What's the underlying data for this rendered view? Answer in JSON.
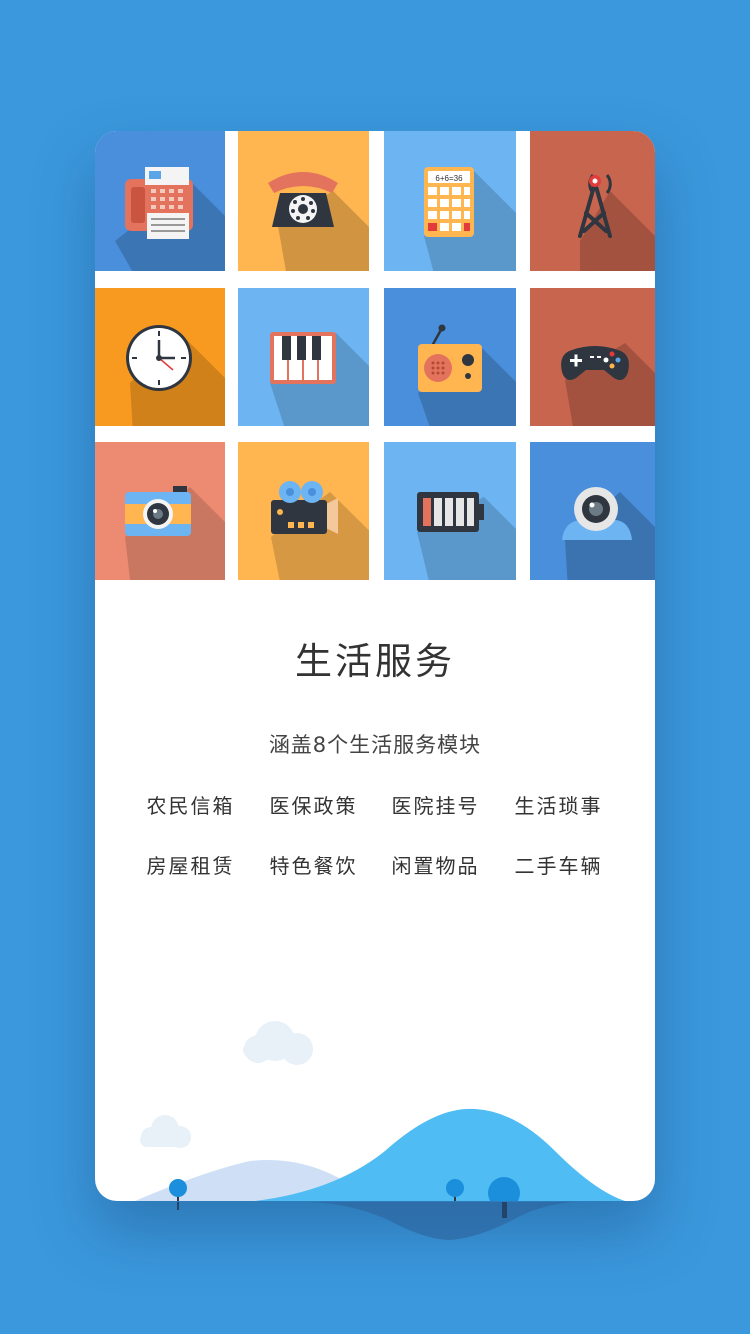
{
  "page": {
    "title": "生活服务",
    "subtitle": "涵盖8个生活服务模块"
  },
  "modules": [
    {
      "label": "农民信箱"
    },
    {
      "label": "医保政策"
    },
    {
      "label": "医院挂号"
    },
    {
      "label": "生活琐事"
    },
    {
      "label": "房屋租赁"
    },
    {
      "label": "特色餐饮"
    },
    {
      "label": "闲置物品"
    },
    {
      "label": "二手车辆"
    }
  ],
  "icons": {
    "calculator_display": "6+6=36",
    "tiles": [
      {
        "icon": "fax-icon",
        "color": "#4a8fdc"
      },
      {
        "icon": "telephone-icon",
        "color": "#ffb550"
      },
      {
        "icon": "calculator-icon",
        "color": "#6cb4f2"
      },
      {
        "icon": "signal-tower-icon",
        "color": "#c8654f"
      },
      {
        "icon": "clock-icon",
        "color": "#f99a20"
      },
      {
        "icon": "piano-icon",
        "color": "#6cb4f2"
      },
      {
        "icon": "radio-icon",
        "color": "#4a8fdc"
      },
      {
        "icon": "gamepad-icon",
        "color": "#c8654f"
      },
      {
        "icon": "camera-icon",
        "color": "#ec8b72"
      },
      {
        "icon": "projector-icon",
        "color": "#ffb550"
      },
      {
        "icon": "battery-icon",
        "color": "#6cb4f2"
      },
      {
        "icon": "webcam-icon",
        "color": "#4a8fdc"
      }
    ]
  }
}
